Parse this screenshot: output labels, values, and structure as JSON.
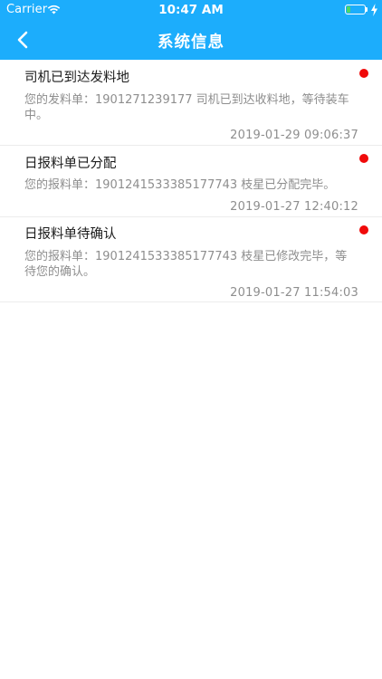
{
  "status_bar": {
    "carrier": "Carrier",
    "time": "10:47 AM",
    "icons": [
      "wifi-icon",
      "battery-icon",
      "charging-bolt-icon"
    ],
    "battery_color": "#4cd964"
  },
  "nav": {
    "title": "系统信息",
    "back_icon": "chevron-left-icon",
    "background": "#1cadfc"
  },
  "messages": [
    {
      "title": "司机已到达发料地",
      "body": "您的发料单：1901271239177 司机已到达收料地，等待装车中。",
      "time": "2019-01-29 09:06:37",
      "unread": true
    },
    {
      "title": "日报料单已分配",
      "body": "您的报料单：1901241533385177743 枝星已分配完毕。",
      "time": "2019-01-27 12:40:12",
      "unread": true
    },
    {
      "title": "日报料单待确认",
      "body": "您的报料单：1901241533385177743 枝星已修改完毕，等待您的确认。",
      "time": "2019-01-27 11:54:03",
      "unread": true
    }
  ],
  "unread_dot_color": "#f00a0a"
}
